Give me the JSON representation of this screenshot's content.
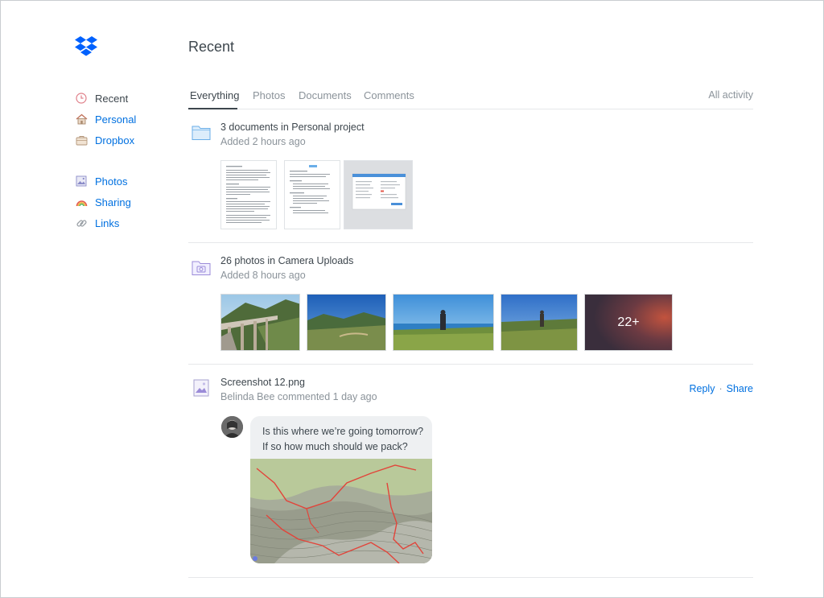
{
  "colors": {
    "accent": "#0070e0",
    "text": "#3d464d",
    "muted": "#8b939a",
    "divider": "#e6e8ea"
  },
  "sidebar": {
    "logo_icon": "dropbox-logo-icon",
    "items": [
      {
        "label": "Recent",
        "icon": "clock-icon",
        "active": true
      },
      {
        "label": "Personal",
        "icon": "house-icon"
      },
      {
        "label": "Dropbox",
        "icon": "briefcase-icon"
      },
      {
        "label": "Photos",
        "icon": "photo-icon"
      },
      {
        "label": "Sharing",
        "icon": "rainbow-icon"
      },
      {
        "label": "Links",
        "icon": "link-icon"
      }
    ]
  },
  "header": {
    "title": "Recent"
  },
  "tabs": [
    {
      "label": "Everything",
      "active": true
    },
    {
      "label": "Photos"
    },
    {
      "label": "Documents"
    },
    {
      "label": "Comments"
    }
  ],
  "all_activity": "All activity",
  "feed": {
    "documents": {
      "title": "3 documents in Personal project",
      "subtitle": "Added 2 hours ago",
      "icon": "folder-icon"
    },
    "photos": {
      "title": "26 photos in Camera Uploads",
      "subtitle": "Added 8 hours ago",
      "more_label": "22+",
      "icon": "camera-folder-icon"
    },
    "comment": {
      "title": "Screenshot 12.png",
      "subtitle": "Belinda Bee commented 1 day ago",
      "icon": "image-file-icon",
      "reply": "Reply",
      "separator": "·",
      "share": "Share",
      "message_line1": "Is this where we’re going tomorrow?",
      "message_line2": "If so how much should we pack?"
    }
  }
}
